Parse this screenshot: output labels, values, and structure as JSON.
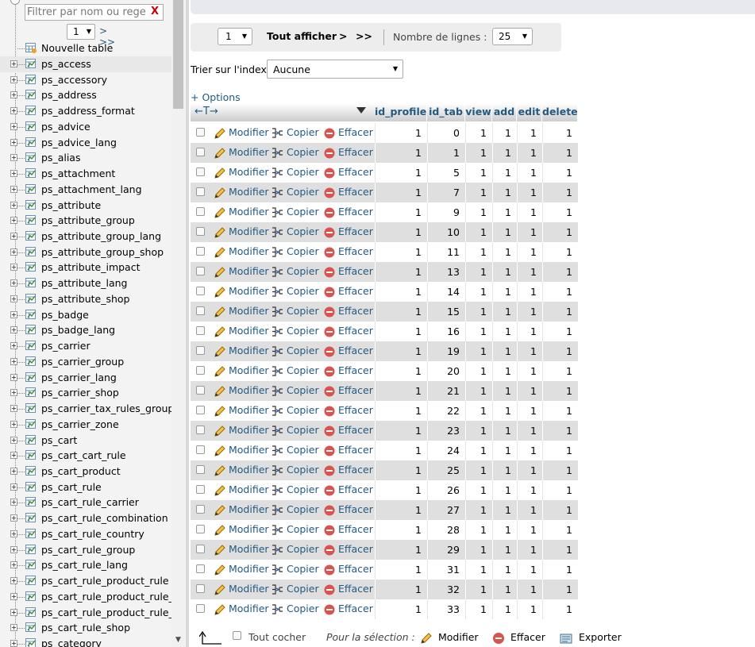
{
  "nav": {
    "filter": {
      "placeholder": "Filtrer par nom ou regex",
      "clear_label": "X"
    },
    "pager": {
      "page": "1",
      "next_label": "> >>"
    },
    "new_table_label": "Nouvelle table",
    "tables": [
      "ps_access",
      "ps_accessory",
      "ps_address",
      "ps_address_format",
      "ps_advice",
      "ps_advice_lang",
      "ps_alias",
      "ps_attachment",
      "ps_attachment_lang",
      "ps_attribute",
      "ps_attribute_group",
      "ps_attribute_group_lang",
      "ps_attribute_group_shop",
      "ps_attribute_impact",
      "ps_attribute_lang",
      "ps_attribute_shop",
      "ps_badge",
      "ps_badge_lang",
      "ps_carrier",
      "ps_carrier_group",
      "ps_carrier_lang",
      "ps_carrier_shop",
      "ps_carrier_tax_rules_group_",
      "ps_carrier_zone",
      "ps_cart",
      "ps_cart_cart_rule",
      "ps_cart_product",
      "ps_cart_rule",
      "ps_cart_rule_carrier",
      "ps_cart_rule_combination",
      "ps_cart_rule_country",
      "ps_cart_rule_group",
      "ps_cart_rule_lang",
      "ps_cart_rule_product_rule",
      "ps_cart_rule_product_rule_g",
      "ps_cart_rule_product_rule_v",
      "ps_cart_rule_shop",
      "ps_category"
    ],
    "selected_index": 0
  },
  "navigation": {
    "page": "1",
    "show_all_label": "Tout afficher",
    "next_label": ">",
    "last_label": ">>",
    "rows_label": "Nombre de lignes :",
    "rows_value": "25"
  },
  "sort": {
    "label": "Trier sur l'index:",
    "value": "Aucune"
  },
  "options_label": "+ Options",
  "table": {
    "header_arrows": "←T→",
    "columns": [
      "id_profile",
      "id_tab",
      "view",
      "add",
      "edit",
      "delete"
    ],
    "actions": {
      "edit": "Modifier",
      "copy": "Copier",
      "delete": "Effacer"
    },
    "rows": [
      [
        "1",
        "0",
        "1",
        "1",
        "1",
        "1"
      ],
      [
        "1",
        "1",
        "1",
        "1",
        "1",
        "1"
      ],
      [
        "1",
        "5",
        "1",
        "1",
        "1",
        "1"
      ],
      [
        "1",
        "7",
        "1",
        "1",
        "1",
        "1"
      ],
      [
        "1",
        "9",
        "1",
        "1",
        "1",
        "1"
      ],
      [
        "1",
        "10",
        "1",
        "1",
        "1",
        "1"
      ],
      [
        "1",
        "11",
        "1",
        "1",
        "1",
        "1"
      ],
      [
        "1",
        "13",
        "1",
        "1",
        "1",
        "1"
      ],
      [
        "1",
        "14",
        "1",
        "1",
        "1",
        "1"
      ],
      [
        "1",
        "15",
        "1",
        "1",
        "1",
        "1"
      ],
      [
        "1",
        "16",
        "1",
        "1",
        "1",
        "1"
      ],
      [
        "1",
        "19",
        "1",
        "1",
        "1",
        "1"
      ],
      [
        "1",
        "20",
        "1",
        "1",
        "1",
        "1"
      ],
      [
        "1",
        "21",
        "1",
        "1",
        "1",
        "1"
      ],
      [
        "1",
        "22",
        "1",
        "1",
        "1",
        "1"
      ],
      [
        "1",
        "23",
        "1",
        "1",
        "1",
        "1"
      ],
      [
        "1",
        "24",
        "1",
        "1",
        "1",
        "1"
      ],
      [
        "1",
        "25",
        "1",
        "1",
        "1",
        "1"
      ],
      [
        "1",
        "26",
        "1",
        "1",
        "1",
        "1"
      ],
      [
        "1",
        "27",
        "1",
        "1",
        "1",
        "1"
      ],
      [
        "1",
        "28",
        "1",
        "1",
        "1",
        "1"
      ],
      [
        "1",
        "29",
        "1",
        "1",
        "1",
        "1"
      ],
      [
        "1",
        "31",
        "1",
        "1",
        "1",
        "1"
      ],
      [
        "1",
        "32",
        "1",
        "1",
        "1",
        "1"
      ],
      [
        "1",
        "33",
        "1",
        "1",
        "1",
        "1"
      ]
    ]
  },
  "bottom": {
    "check_all_label": "Tout cocher",
    "for_selection_label": "Pour la sélection :",
    "edit_label": "Modifier",
    "delete_label": "Effacer",
    "export_label": "Exporter"
  },
  "colors": {
    "link": "#235a81",
    "row_alt": "#dfdfdf",
    "delete_icon": "#d9534f"
  }
}
